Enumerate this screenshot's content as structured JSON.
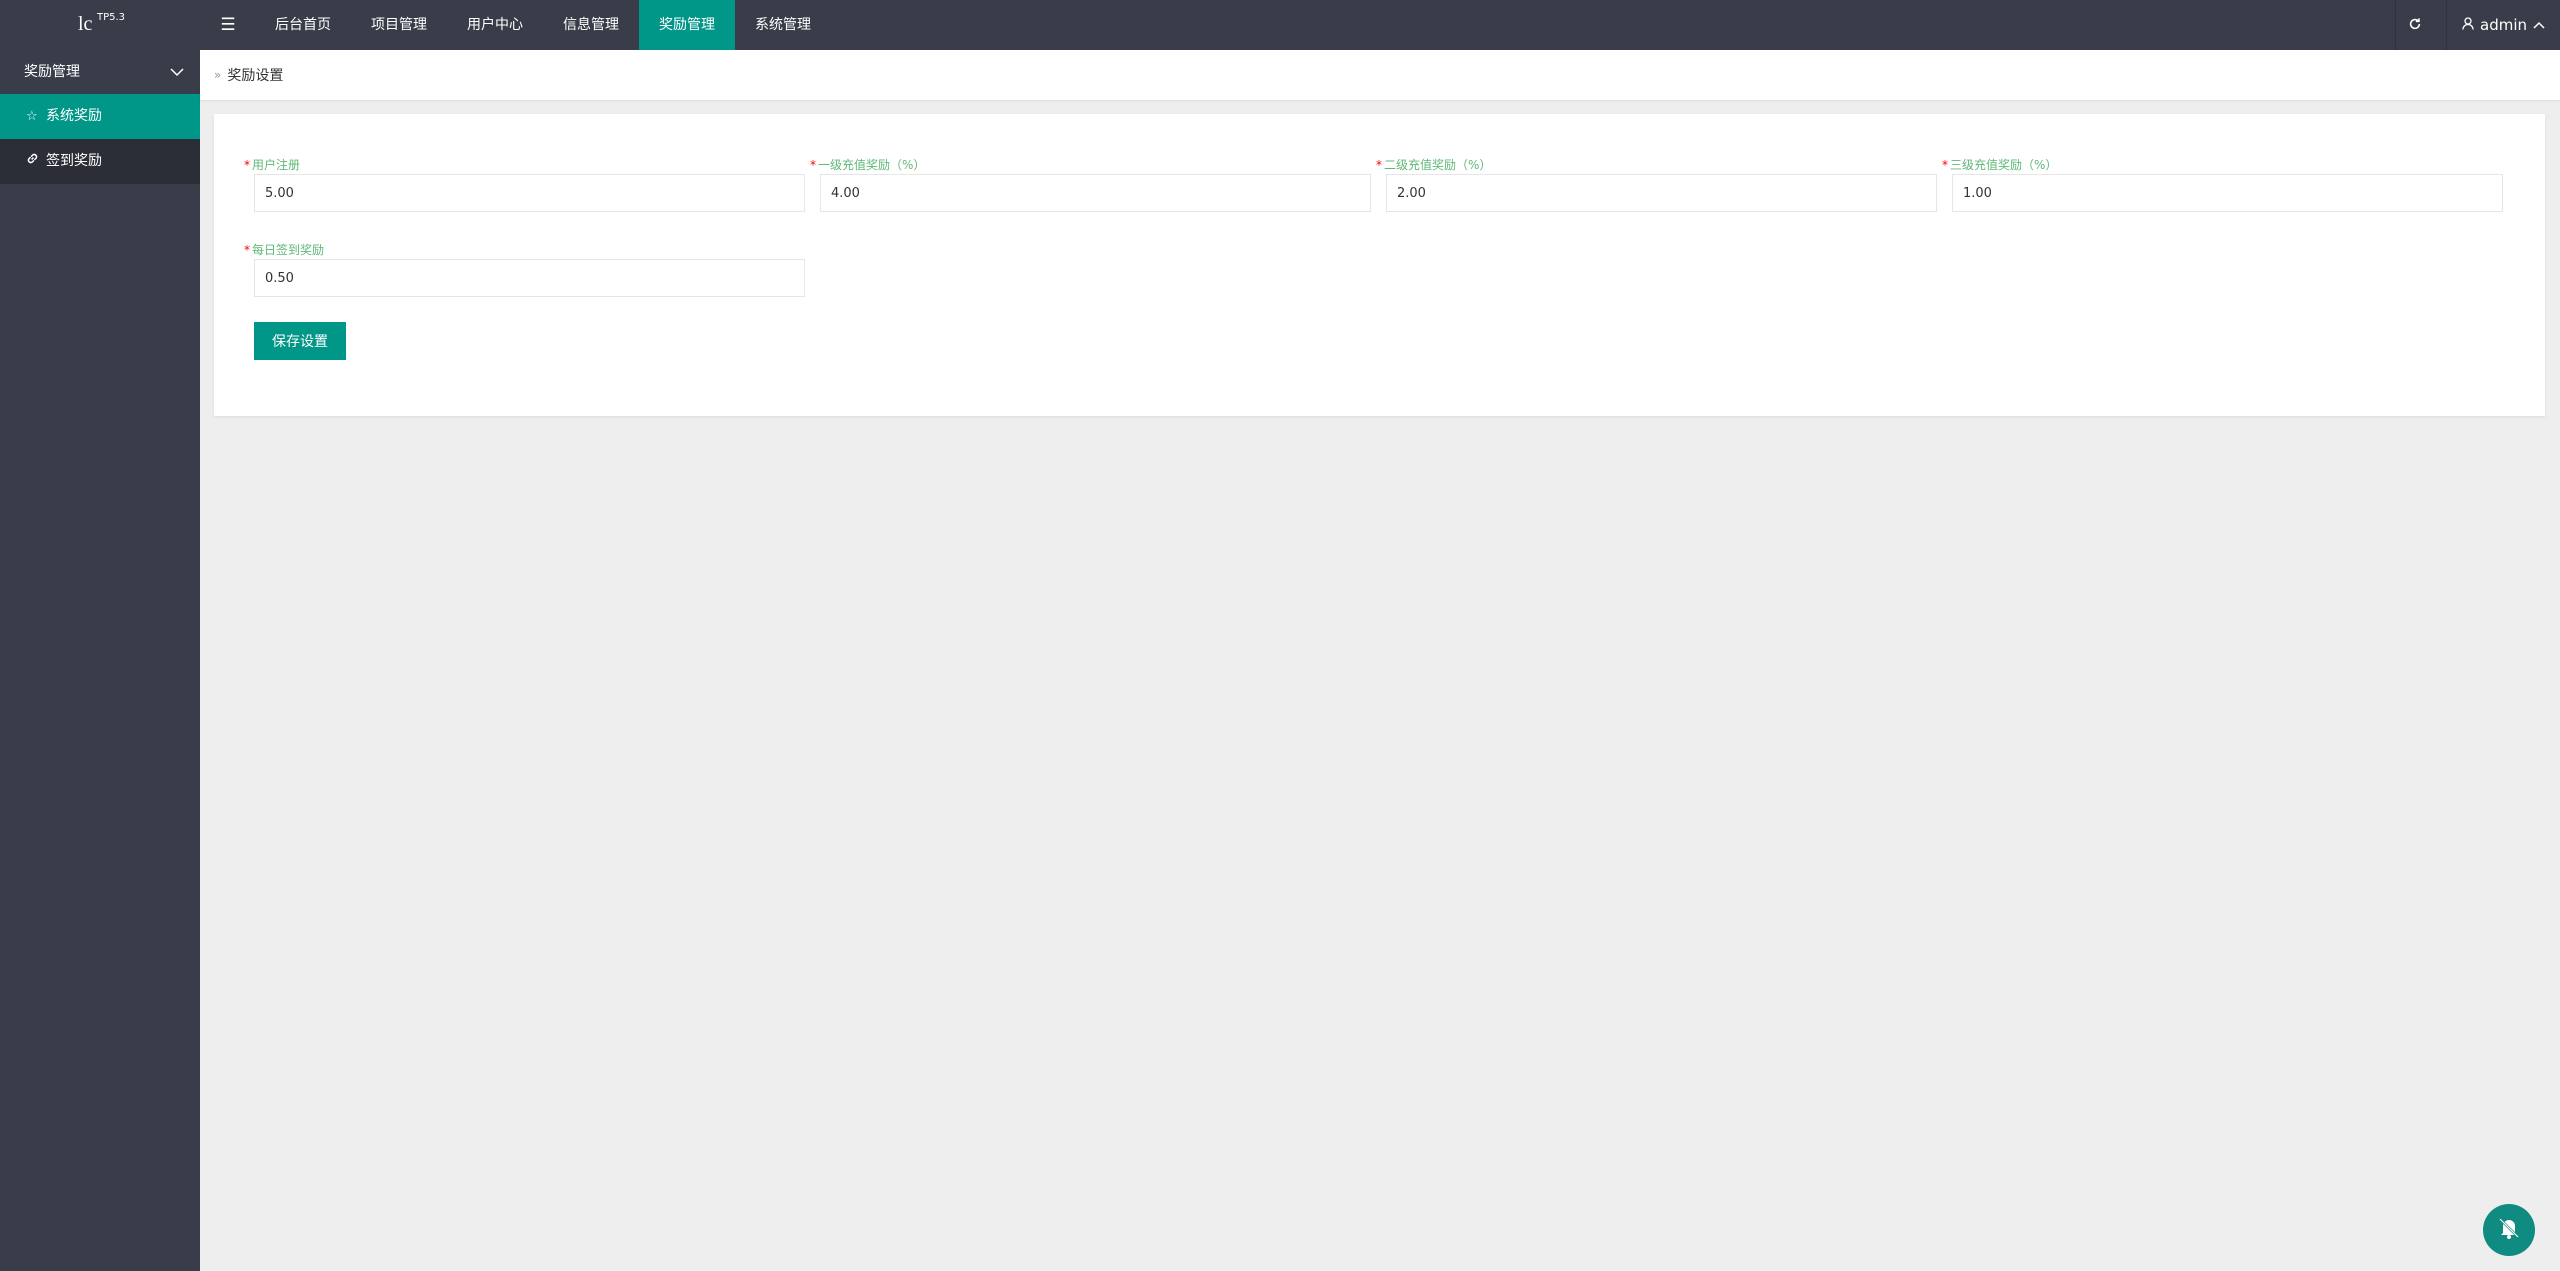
{
  "header": {
    "logo": "lc",
    "logo_version": "TP5.3",
    "menu_toggle_icon": "hamburger-icon",
    "nav": [
      {
        "label": "后台首页",
        "active": false
      },
      {
        "label": "项目管理",
        "active": false
      },
      {
        "label": "用户中心",
        "active": false
      },
      {
        "label": "信息管理",
        "active": false
      },
      {
        "label": "奖励管理",
        "active": true
      },
      {
        "label": "系统管理",
        "active": false
      }
    ],
    "refresh_icon": "refresh-icon",
    "user": "admin"
  },
  "sidebar": {
    "group": "奖励管理",
    "items": [
      {
        "label": "系统奖励",
        "icon": "star-icon",
        "active": true
      },
      {
        "label": "签到奖励",
        "icon": "link-icon",
        "active": false
      }
    ]
  },
  "breadcrumb": {
    "current": "奖励设置"
  },
  "form": {
    "required_mark": "*",
    "fields": [
      {
        "label": "用户注册",
        "value": "5.00"
      },
      {
        "label": "一级充值奖励（%）",
        "value": "4.00"
      },
      {
        "label": "二级充值奖励（%）",
        "value": "2.00"
      },
      {
        "label": "三级充值奖励（%）",
        "value": "1.00"
      },
      {
        "label": "每日签到奖励",
        "value": "0.50"
      }
    ],
    "save_label": "保存设置"
  },
  "colors": {
    "header_bg": "#393d49",
    "accent": "#009688",
    "label_green": "#5fb878",
    "required_red": "#ff0000"
  }
}
